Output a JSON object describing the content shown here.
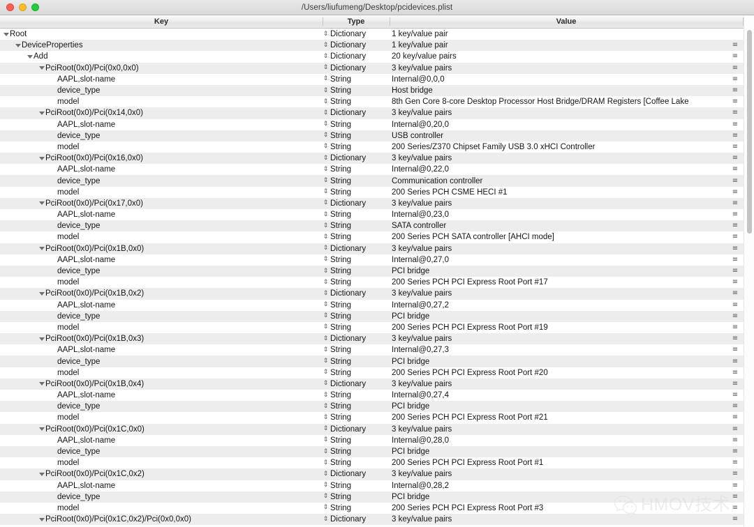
{
  "window": {
    "title": "/Users/liufumeng/Desktop/pcidevices.plist",
    "traffic_lights": [
      {
        "name": "close-button",
        "color": "#ff5f57"
      },
      {
        "name": "minimize-button",
        "color": "#ffbd2e"
      },
      {
        "name": "zoom-button",
        "color": "#28c840"
      }
    ]
  },
  "columns": {
    "key": "Key",
    "type": "Type",
    "value": "Value"
  },
  "icons": {
    "disclosure_open": "disclosure-triangle-open-icon",
    "type_stepper": "⇕",
    "row_menu": "≡"
  },
  "watermark": {
    "text": "HMOV技术",
    "logo": "wechat-logo-icon"
  },
  "rows": [
    {
      "indent": 0,
      "disclosure": "open",
      "key": "Root",
      "type": "Dictionary",
      "value": "1 key/value pair",
      "menu": false
    },
    {
      "indent": 1,
      "disclosure": "open",
      "key": "DeviceProperties",
      "type": "Dictionary",
      "value": "1 key/value pair",
      "menu": true
    },
    {
      "indent": 2,
      "disclosure": "open",
      "key": "Add",
      "type": "Dictionary",
      "value": "20 key/value pairs",
      "menu": true
    },
    {
      "indent": 3,
      "disclosure": "open",
      "key": "PciRoot(0x0)/Pci(0x0,0x0)",
      "type": "Dictionary",
      "value": "3 key/value pairs",
      "menu": true
    },
    {
      "indent": 4,
      "disclosure": "none",
      "key": "AAPL,slot-name",
      "type": "String",
      "value": "Internal@0,0,0",
      "menu": true
    },
    {
      "indent": 4,
      "disclosure": "none",
      "key": "device_type",
      "type": "String",
      "value": "Host bridge",
      "menu": true
    },
    {
      "indent": 4,
      "disclosure": "none",
      "key": "model",
      "type": "String",
      "value": "8th Gen Core 8-core Desktop Processor Host Bridge/DRAM Registers [Coffee Lake",
      "menu": true
    },
    {
      "indent": 3,
      "disclosure": "open",
      "key": "PciRoot(0x0)/Pci(0x14,0x0)",
      "type": "Dictionary",
      "value": "3 key/value pairs",
      "menu": true
    },
    {
      "indent": 4,
      "disclosure": "none",
      "key": "AAPL,slot-name",
      "type": "String",
      "value": "Internal@0,20,0",
      "menu": true
    },
    {
      "indent": 4,
      "disclosure": "none",
      "key": "device_type",
      "type": "String",
      "value": "USB controller",
      "menu": true
    },
    {
      "indent": 4,
      "disclosure": "none",
      "key": "model",
      "type": "String",
      "value": "200 Series/Z370 Chipset Family USB 3.0 xHCI Controller",
      "menu": true
    },
    {
      "indent": 3,
      "disclosure": "open",
      "key": "PciRoot(0x0)/Pci(0x16,0x0)",
      "type": "Dictionary",
      "value": "3 key/value pairs",
      "menu": true
    },
    {
      "indent": 4,
      "disclosure": "none",
      "key": "AAPL,slot-name",
      "type": "String",
      "value": "Internal@0,22,0",
      "menu": true
    },
    {
      "indent": 4,
      "disclosure": "none",
      "key": "device_type",
      "type": "String",
      "value": "Communication controller",
      "menu": true
    },
    {
      "indent": 4,
      "disclosure": "none",
      "key": "model",
      "type": "String",
      "value": "200 Series PCH CSME HECI #1",
      "menu": true
    },
    {
      "indent": 3,
      "disclosure": "open",
      "key": "PciRoot(0x0)/Pci(0x17,0x0)",
      "type": "Dictionary",
      "value": "3 key/value pairs",
      "menu": true
    },
    {
      "indent": 4,
      "disclosure": "none",
      "key": "AAPL,slot-name",
      "type": "String",
      "value": "Internal@0,23,0",
      "menu": true
    },
    {
      "indent": 4,
      "disclosure": "none",
      "key": "device_type",
      "type": "String",
      "value": "SATA controller",
      "menu": true
    },
    {
      "indent": 4,
      "disclosure": "none",
      "key": "model",
      "type": "String",
      "value": "200 Series PCH SATA controller [AHCI mode]",
      "menu": true
    },
    {
      "indent": 3,
      "disclosure": "open",
      "key": "PciRoot(0x0)/Pci(0x1B,0x0)",
      "type": "Dictionary",
      "value": "3 key/value pairs",
      "menu": true
    },
    {
      "indent": 4,
      "disclosure": "none",
      "key": "AAPL,slot-name",
      "type": "String",
      "value": "Internal@0,27,0",
      "menu": true
    },
    {
      "indent": 4,
      "disclosure": "none",
      "key": "device_type",
      "type": "String",
      "value": "PCI bridge",
      "menu": true
    },
    {
      "indent": 4,
      "disclosure": "none",
      "key": "model",
      "type": "String",
      "value": "200 Series PCH PCI Express Root Port #17",
      "menu": true
    },
    {
      "indent": 3,
      "disclosure": "open",
      "key": "PciRoot(0x0)/Pci(0x1B,0x2)",
      "type": "Dictionary",
      "value": "3 key/value pairs",
      "menu": true
    },
    {
      "indent": 4,
      "disclosure": "none",
      "key": "AAPL,slot-name",
      "type": "String",
      "value": "Internal@0,27,2",
      "menu": true
    },
    {
      "indent": 4,
      "disclosure": "none",
      "key": "device_type",
      "type": "String",
      "value": "PCI bridge",
      "menu": true
    },
    {
      "indent": 4,
      "disclosure": "none",
      "key": "model",
      "type": "String",
      "value": "200 Series PCH PCI Express Root Port #19",
      "menu": true
    },
    {
      "indent": 3,
      "disclosure": "open",
      "key": "PciRoot(0x0)/Pci(0x1B,0x3)",
      "type": "Dictionary",
      "value": "3 key/value pairs",
      "menu": true
    },
    {
      "indent": 4,
      "disclosure": "none",
      "key": "AAPL,slot-name",
      "type": "String",
      "value": "Internal@0,27,3",
      "menu": true
    },
    {
      "indent": 4,
      "disclosure": "none",
      "key": "device_type",
      "type": "String",
      "value": "PCI bridge",
      "menu": true
    },
    {
      "indent": 4,
      "disclosure": "none",
      "key": "model",
      "type": "String",
      "value": "200 Series PCH PCI Express Root Port #20",
      "menu": true
    },
    {
      "indent": 3,
      "disclosure": "open",
      "key": "PciRoot(0x0)/Pci(0x1B,0x4)",
      "type": "Dictionary",
      "value": "3 key/value pairs",
      "menu": true
    },
    {
      "indent": 4,
      "disclosure": "none",
      "key": "AAPL,slot-name",
      "type": "String",
      "value": "Internal@0,27,4",
      "menu": true
    },
    {
      "indent": 4,
      "disclosure": "none",
      "key": "device_type",
      "type": "String",
      "value": "PCI bridge",
      "menu": true
    },
    {
      "indent": 4,
      "disclosure": "none",
      "key": "model",
      "type": "String",
      "value": "200 Series PCH PCI Express Root Port #21",
      "menu": true
    },
    {
      "indent": 3,
      "disclosure": "open",
      "key": "PciRoot(0x0)/Pci(0x1C,0x0)",
      "type": "Dictionary",
      "value": "3 key/value pairs",
      "menu": true
    },
    {
      "indent": 4,
      "disclosure": "none",
      "key": "AAPL,slot-name",
      "type": "String",
      "value": "Internal@0,28,0",
      "menu": true
    },
    {
      "indent": 4,
      "disclosure": "none",
      "key": "device_type",
      "type": "String",
      "value": "PCI bridge",
      "menu": true
    },
    {
      "indent": 4,
      "disclosure": "none",
      "key": "model",
      "type": "String",
      "value": "200 Series PCH PCI Express Root Port #1",
      "menu": true
    },
    {
      "indent": 3,
      "disclosure": "open",
      "key": "PciRoot(0x0)/Pci(0x1C,0x2)",
      "type": "Dictionary",
      "value": "3 key/value pairs",
      "menu": true
    },
    {
      "indent": 4,
      "disclosure": "none",
      "key": "AAPL,slot-name",
      "type": "String",
      "value": "Internal@0,28,2",
      "menu": true
    },
    {
      "indent": 4,
      "disclosure": "none",
      "key": "device_type",
      "type": "String",
      "value": "PCI bridge",
      "menu": true
    },
    {
      "indent": 4,
      "disclosure": "none",
      "key": "model",
      "type": "String",
      "value": "200 Series PCH PCI Express Root Port #3",
      "menu": true
    },
    {
      "indent": 3,
      "disclosure": "open",
      "key": "PciRoot(0x0)/Pci(0x1C,0x2)/Pci(0x0,0x0)",
      "type": "Dictionary",
      "value": "3 key/value pairs",
      "menu": true
    }
  ]
}
